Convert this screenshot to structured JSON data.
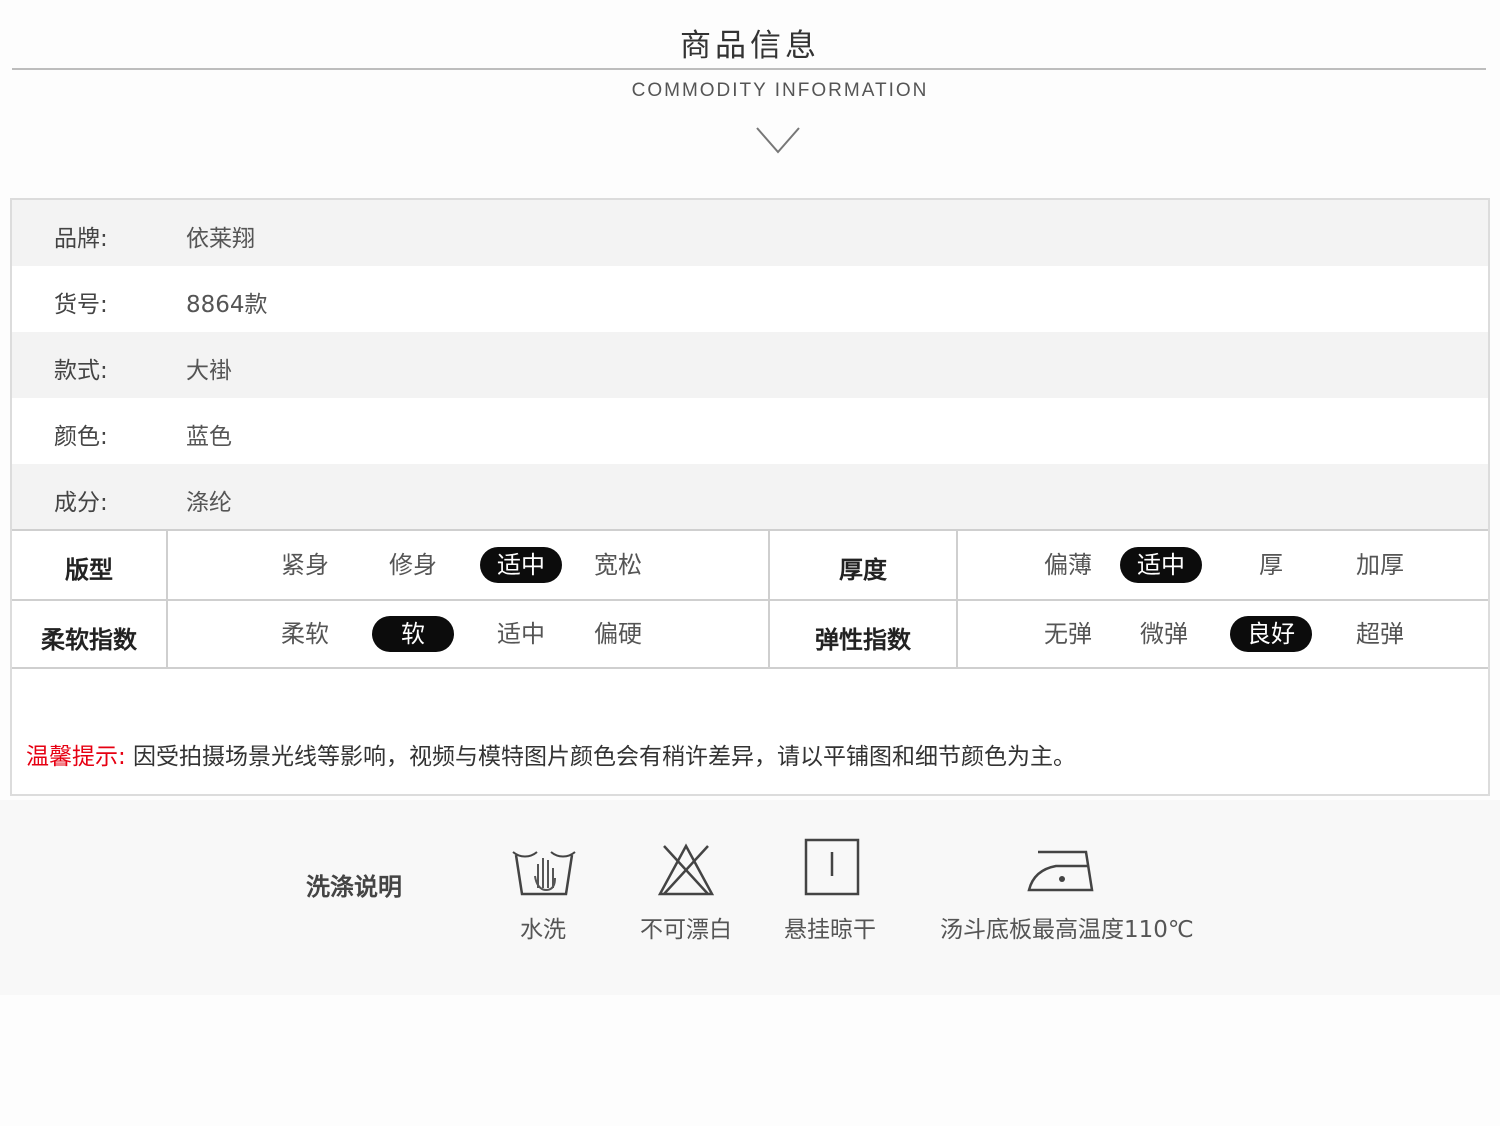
{
  "header": {
    "title": "商品信息",
    "subtitle": "COMMODITY INFORMATION"
  },
  "attributes": [
    {
      "label": "品牌:",
      "value": "依莱翔"
    },
    {
      "label": "货号:",
      "value": "8864款"
    },
    {
      "label": "款式:",
      "value": "大褂"
    },
    {
      "label": "颜色:",
      "value": "蓝色"
    },
    {
      "label": "成分:",
      "value": "涤纶"
    }
  ],
  "indices": {
    "fit": {
      "label": "版型",
      "options": [
        "紧身",
        "修身",
        "适中",
        "宽松"
      ],
      "selected": "适中"
    },
    "thickness": {
      "label": "厚度",
      "options": [
        "偏薄",
        "适中",
        "厚",
        "加厚"
      ],
      "selected": "适中"
    },
    "softness": {
      "label": "柔软指数",
      "options": [
        "柔软",
        "软",
        "适中",
        "偏硬"
      ],
      "selected": "软"
    },
    "elasticity": {
      "label": "弹性指数",
      "options": [
        "无弹",
        "微弹",
        "良好",
        "超弹"
      ],
      "selected": "良好"
    }
  },
  "tip": {
    "prefix": "温馨提示:",
    "text": " 因受拍摄场景光线等影响，视频与模特图片颜色会有稍许差异，请以平铺图和细节颜色为主。"
  },
  "wash": {
    "title": "洗涤说明",
    "items": [
      {
        "label": "水洗",
        "icon": "hand-wash-icon"
      },
      {
        "label": "不可漂白",
        "icon": "no-bleach-icon"
      },
      {
        "label": "悬挂晾干",
        "icon": "hang-dry-icon"
      },
      {
        "label": "汤斗底板最高温度110℃",
        "icon": "iron-icon"
      }
    ]
  },
  "colors": {
    "accent_red": "#e60012",
    "selected_pill": "#0c0c0c"
  }
}
